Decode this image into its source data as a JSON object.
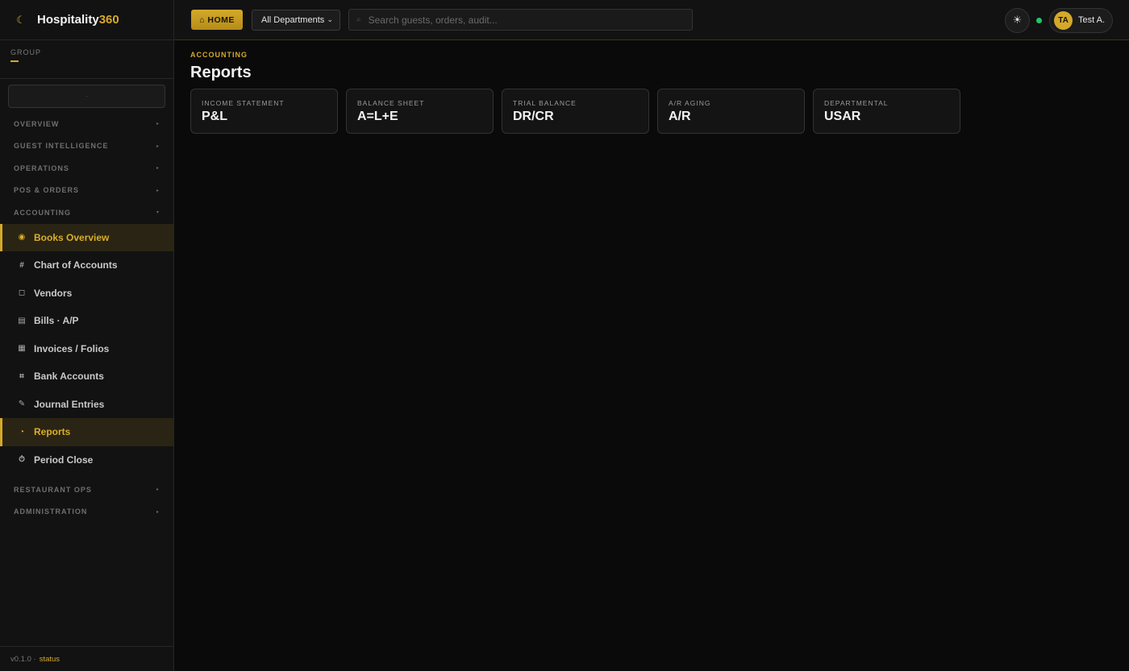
{
  "app": {
    "name_prefix": "Hospitality",
    "name_accent": "360"
  },
  "sidebar": {
    "group_label": "GROUP",
    "selector_value": "·",
    "sections": [
      {
        "label": "OVERVIEW",
        "expanded": false
      },
      {
        "label": "GUEST INTELLIGENCE",
        "expanded": false
      },
      {
        "label": "OPERATIONS",
        "expanded": false
      },
      {
        "label": "POS & ORDERS",
        "expanded": false
      },
      {
        "label": "ACCOUNTING",
        "expanded": true
      },
      {
        "label": "RESTAURANT OPS",
        "expanded": false
      },
      {
        "label": "ADMINISTRATION",
        "expanded": false
      }
    ],
    "accounting_items": [
      {
        "label": "Books Overview",
        "icon": "◉",
        "icon_name": "books-overview-icon"
      },
      {
        "label": "Chart of Accounts",
        "icon": "#",
        "icon_name": "hash-icon"
      },
      {
        "label": "Vendors",
        "icon": "◻",
        "icon_name": "vendor-icon"
      },
      {
        "label": "Bills · A/P",
        "icon": "▤",
        "icon_name": "bills-icon"
      },
      {
        "label": "Invoices / Folios",
        "icon": "▦",
        "icon_name": "invoice-icon"
      },
      {
        "label": "Bank Accounts",
        "icon": "⌗",
        "icon_name": "bank-icon"
      },
      {
        "label": "Journal Entries",
        "icon": "✎",
        "icon_name": "pencil-icon"
      },
      {
        "label": "Reports",
        "icon": "◔",
        "icon_name": "pie-chart-icon"
      },
      {
        "label": "Period Close",
        "icon": "⏱",
        "icon_name": "timer-icon"
      }
    ],
    "footer_version": "v0.1.0 ·",
    "footer_link": "status"
  },
  "topbar": {
    "home_label": "⌂ HOME",
    "department_select": "All Departments",
    "search_placeholder": "Search guests, orders, audit...",
    "user_initials": "TA",
    "user_name": "Test A.",
    "theme_icon": "☀"
  },
  "main": {
    "eyebrow": "ACCOUNTING",
    "title": "Reports",
    "cards": [
      {
        "label": "INCOME STATEMENT",
        "value": "P&L"
      },
      {
        "label": "BALANCE SHEET",
        "value": "A=L+E"
      },
      {
        "label": "TRIAL BALANCE",
        "value": "DR/CR"
      },
      {
        "label": "A/R AGING",
        "value": "A/R"
      },
      {
        "label": "DEPARTMENTAL",
        "value": "USAR"
      }
    ]
  },
  "colors": {
    "accent": "#d4a92a",
    "background": "#0a0a0a",
    "online": "#21c66b"
  }
}
